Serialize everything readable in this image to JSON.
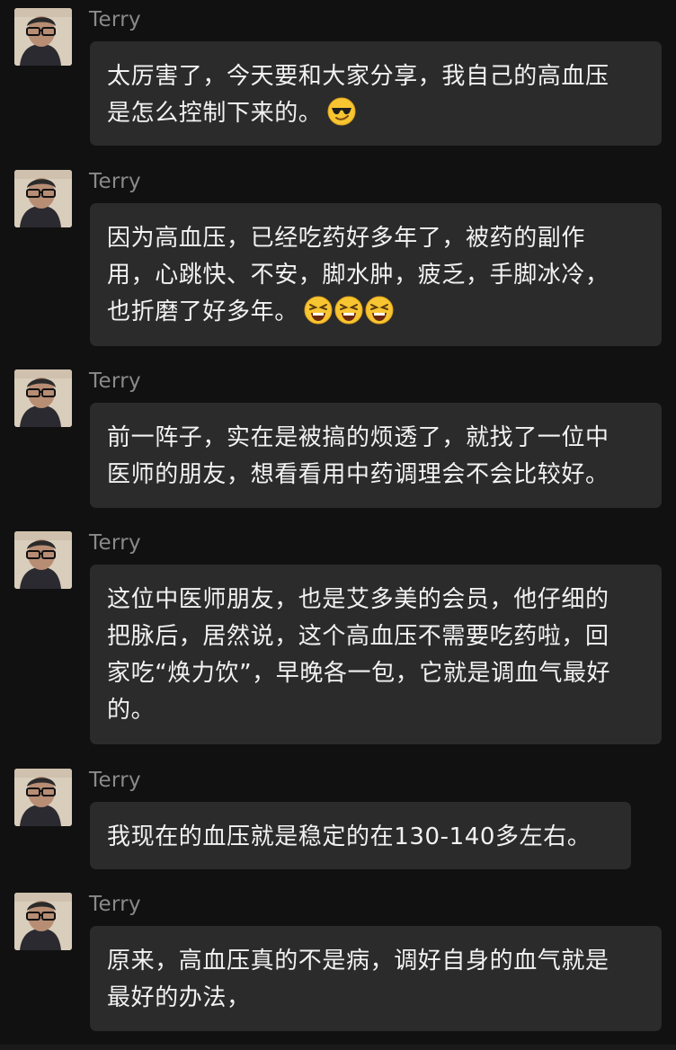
{
  "messages": [
    {
      "sender": "Terry",
      "text": "太厉害了，今天要和大家分享，我自己的高血压\n是怎么控制下来的。",
      "emoji": [
        "smiling-face-with-sunglasses"
      ]
    },
    {
      "sender": "Terry",
      "text": "因为高血压，已经吃药好多年了，被药的副作\n用，心跳快、不安，脚水肿，疲乏，手脚冰冷，\n也折磨了好多年。",
      "emoji": [
        "tired-face",
        "tired-face",
        "tired-face"
      ]
    },
    {
      "sender": "Terry",
      "text": "前一阵子，实在是被搞的烦透了，就找了一位中\n医师的朋友，想看看用中药调理会不会比较好。",
      "emoji": []
    },
    {
      "sender": "Terry",
      "text": "这位中医师朋友，也是艾多美的会员，他仔细的\n把脉后，居然说，这个高血压不需要吃药啦，回\n家吃“焕力饮”，早晚各一包，它就是调血气最好\n的。",
      "emoji": []
    },
    {
      "sender": "Terry",
      "text": "我现在的血压就是稳定的在130-140多左右。",
      "emoji": []
    },
    {
      "sender": "Terry",
      "text": "原来，高血压真的不是病，调好自身的血气就是\n最好的办法，",
      "emoji": []
    }
  ],
  "colors": {
    "background": "#111111",
    "bubble": "#2b2b2b",
    "message_text": "#f2f2f2",
    "sender_text": "#8a8a8a"
  }
}
